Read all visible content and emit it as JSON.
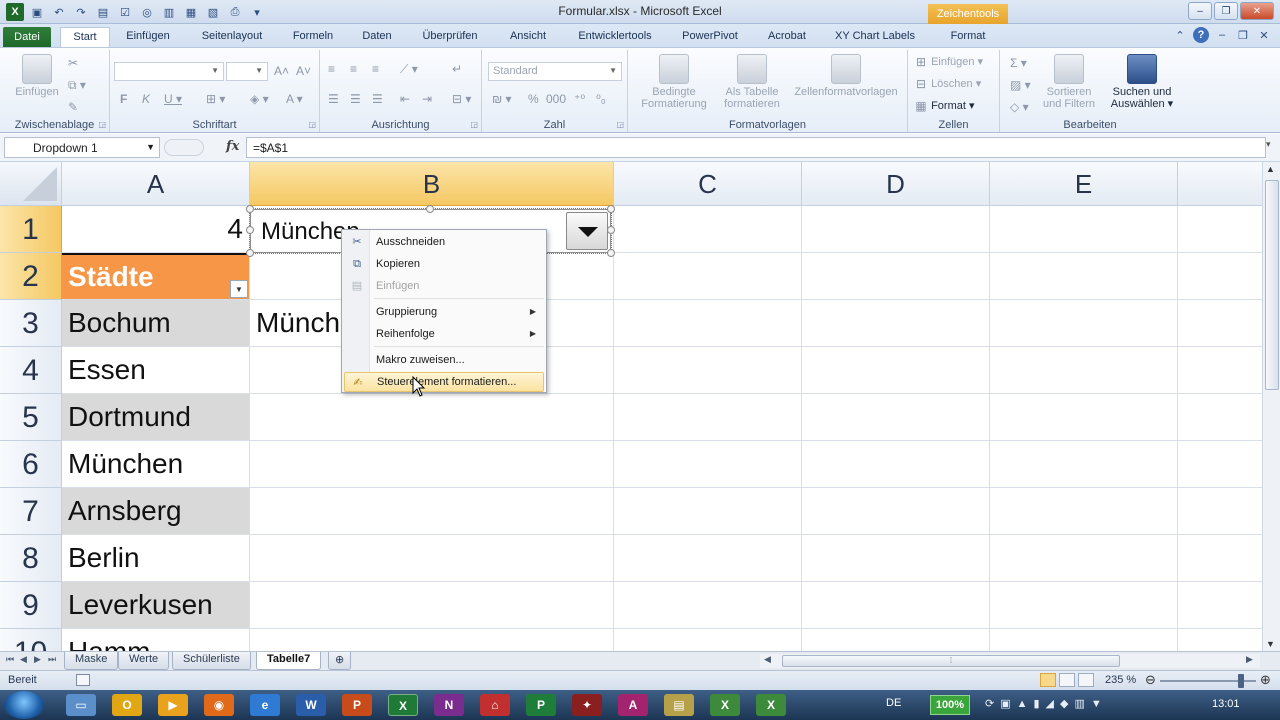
{
  "window": {
    "title": "Formular.xlsx - Microsoft Excel",
    "context_tab_group": "Zeichentools"
  },
  "ribbon_tabs": [
    {
      "label": "Datei"
    },
    {
      "label": "Start"
    },
    {
      "label": "Einfügen"
    },
    {
      "label": "Seitenlayout"
    },
    {
      "label": "Formeln"
    },
    {
      "label": "Daten"
    },
    {
      "label": "Überprüfen"
    },
    {
      "label": "Ansicht"
    },
    {
      "label": "Entwicklertools"
    },
    {
      "label": "PowerPivot"
    },
    {
      "label": "Acrobat"
    },
    {
      "label": "XY Chart Labels"
    },
    {
      "label": "Format"
    }
  ],
  "ribbon": {
    "clipboard": {
      "label": "Zwischenablage",
      "paste": "Einfügen"
    },
    "font": {
      "label": "Schriftart"
    },
    "alignment": {
      "label": "Ausrichtung"
    },
    "number": {
      "label": "Zahl",
      "format_value": "Standard"
    },
    "styles": {
      "label": "Formatvorlagen",
      "conditional_1": "Bedingte",
      "conditional_2": "Formatierung",
      "as_table_1": "Als Tabelle",
      "as_table_2": "formatieren",
      "cell_styles": "Zellenformatvorlagen"
    },
    "cells": {
      "label": "Zellen",
      "insert": "Einfügen",
      "delete": "Löschen",
      "format": "Format"
    },
    "editing": {
      "label": "Bearbeiten",
      "sort_1": "Sortieren",
      "sort_2": "und Filtern",
      "find_1": "Suchen und",
      "find_2": "Auswählen"
    }
  },
  "formula_bar": {
    "name_box": "Dropdown 1",
    "fx": "fx",
    "formula": "=$A$1"
  },
  "columns": [
    "A",
    "B",
    "C",
    "D",
    "E"
  ],
  "rows": [
    "1",
    "2",
    "3",
    "4",
    "5",
    "6",
    "7",
    "8",
    "9",
    "10"
  ],
  "cells": {
    "A1": "4",
    "A2": "Städte",
    "A3": "Bochum",
    "A4": "Essen",
    "A5": "Dortmund",
    "A6": "München",
    "A7": "Arnsberg",
    "A8": "Berlin",
    "A9": "Leverkusen",
    "A10": "Hamm",
    "B3": "München"
  },
  "dropdown_control": {
    "value": "München"
  },
  "context_menu": [
    {
      "label": "Ausschneiden",
      "enabled": true,
      "icon": "scissors-icon"
    },
    {
      "label": "Kopieren",
      "enabled": true,
      "icon": "copy-icon"
    },
    {
      "label": "Einfügen",
      "enabled": false,
      "icon": "paste-icon"
    },
    {
      "label": "Gruppierung",
      "enabled": true,
      "submenu": true
    },
    {
      "label": "Reihenfolge",
      "enabled": true,
      "submenu": true
    },
    {
      "label": "Makro zuweisen...",
      "enabled": true
    },
    {
      "label": "Steuerelement formatieren...",
      "enabled": true,
      "icon": "format-control-icon",
      "highlighted": true
    }
  ],
  "sheet_tabs": [
    {
      "label": "Maske"
    },
    {
      "label": "Werte"
    },
    {
      "label": "Schülerliste"
    },
    {
      "label": "Tabelle7",
      "active": true
    }
  ],
  "status": {
    "mode": "Bereit",
    "zoom": "235 %",
    "zoom_percent": 235
  },
  "taskbar": {
    "language": "DE",
    "battery": "100%",
    "clock": "13:01"
  },
  "colors": {
    "header_fill": "#f79646",
    "shade_fill": "#d9d9d9",
    "file_tab": "#217346",
    "selection_header": "#f5c863"
  }
}
